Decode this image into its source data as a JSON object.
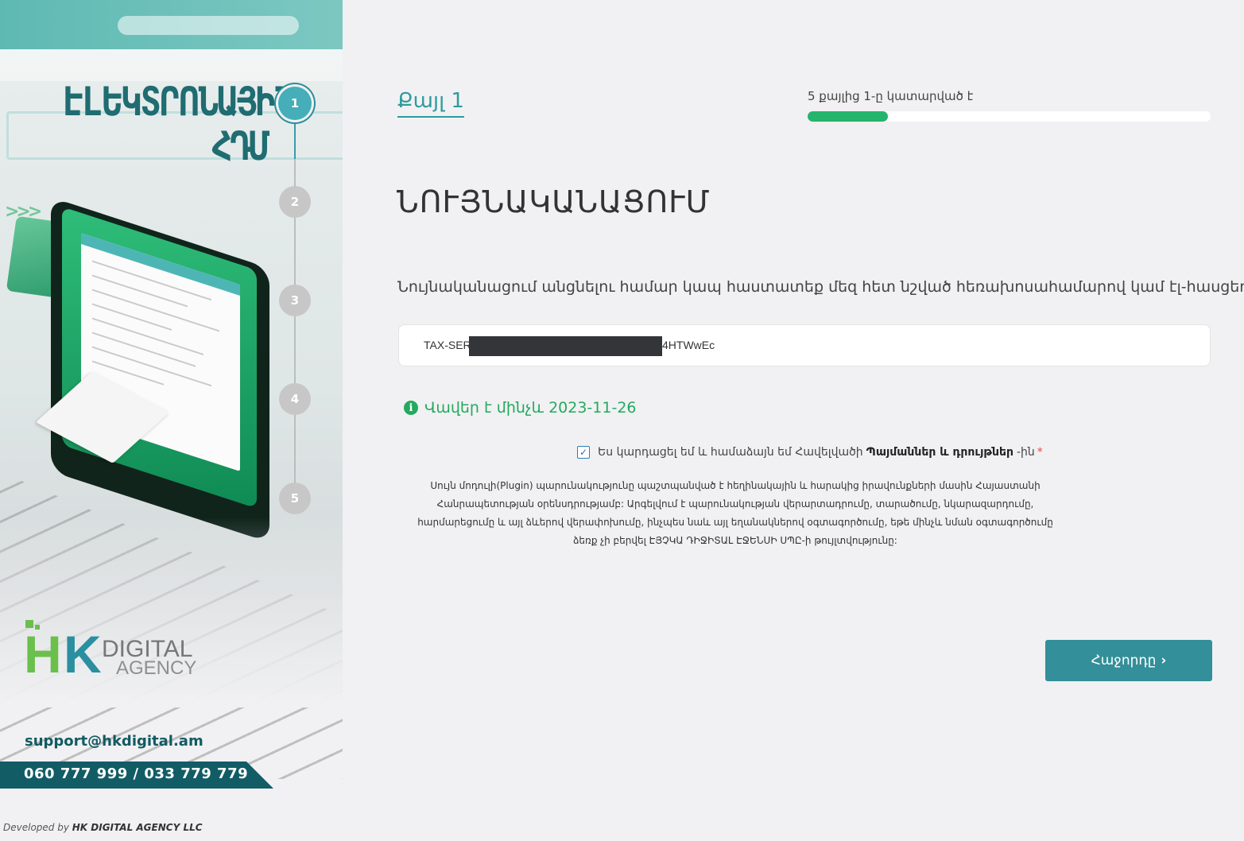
{
  "sidebar": {
    "brand_line1": "ԷԼԵԿՏՐՈՆԱՅԻՆ",
    "brand_line2": "ՀԴՄ",
    "steps": [
      "1",
      "2",
      "3",
      "4",
      "5"
    ],
    "active_step": 1,
    "logo": {
      "hk": "HK",
      "digital": "DIGITAL",
      "agency": "AGENCY"
    },
    "support_email": "support@hkdigital.am",
    "phones": "060 777 999 / 033 779 779",
    "developed_by_prefix": "Developed by",
    "developed_by_company": "HK DIGITAL AGENCY LLC"
  },
  "main": {
    "step_label": "Քայլ 1",
    "progress_text": "5 քայլից 1-ը կատարված է",
    "progress_fraction": 0.2,
    "heading": "ՆՈՒՅՆԱԿԱՆԱՑՈՒՄ",
    "instruction": "Նույնականացում անցնելու համար կապ հաստատեք մեզ հետ նշված հեռախոսահամարով կամ էլ-հասցեով:",
    "serial_prefix": "TAX-SER",
    "serial_suffix": "4HTWwEc",
    "valid_until": "Վավեր է մինչև 2023-11-26",
    "agree_text_before": "Ես կարդացել եմ և համաձայն եմ Հավելվածի",
    "agree_link": "Պայմաններ և դրույթներ",
    "agree_text_after": "-ին",
    "agree_required_mark": "*",
    "notice": "Սույն մոդուլի(Plugin) պարունակությունը պաշտպանված է հեղինակային և հարակից իրավունքների մասին Հայաստանի Հանրապետության օրենսդրությամբ: Արգելվում է պարունակության վերարտադրումը, տարածումը, նկարազարդումը, հարմարեցումը և այլ ձևերով վերափոխումը, ինչպես նաև այլ եղանակներով օգտագործումը, եթե մինչև նման օգտագործումը ձեռք չի բերվել ԷՅՉԿԱ ԴԻՋԻՏԱԼ ԷՋԵՆՍԻ ՍՊԸ-ի թույլտվությունը:",
    "next_button": "Հաջորդը",
    "colors": {
      "accent": "#338f99",
      "progress": "#24b46c",
      "valid": "#24a95e"
    }
  }
}
